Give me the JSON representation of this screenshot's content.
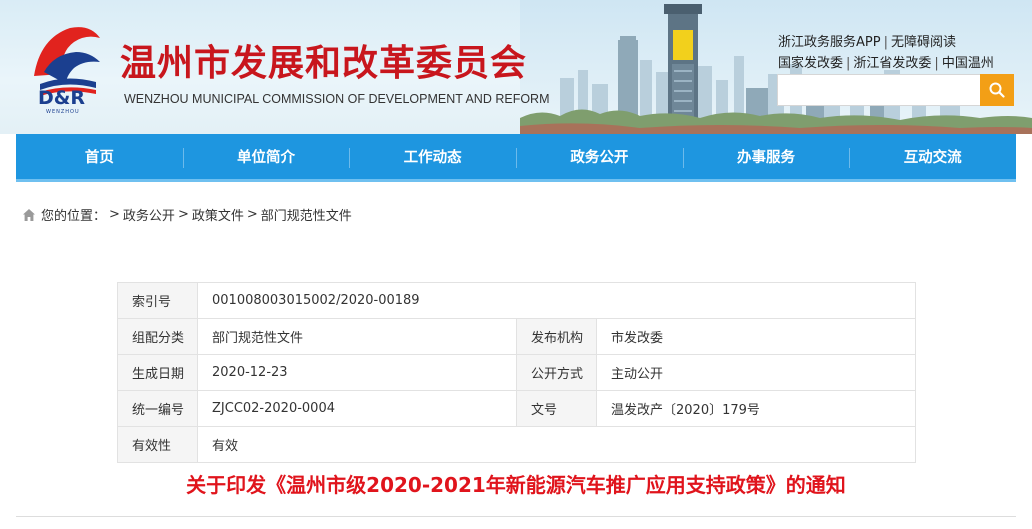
{
  "header": {
    "logo_text": "D&R",
    "logo_subtext": "WENZHOU",
    "site_title": "温州市发展和改革委员会",
    "site_title_en": "WENZHOU MUNICIPAL COMMISSION OF DEVELOPMENT AND REFORM",
    "links_row1": [
      "浙江政务服务APP",
      "无障碍阅读"
    ],
    "links_row2": [
      "国家发改委",
      "浙江省发改委",
      "中国温州"
    ],
    "separator": "|",
    "search": {
      "placeholder": "",
      "icon": "search-icon"
    },
    "accent_color": "#f39f16"
  },
  "nav": {
    "items": [
      "首页",
      "单位简介",
      "工作动态",
      "政务公开",
      "办事服务",
      "互动交流"
    ],
    "color": "#1e96e0"
  },
  "breadcrumb": {
    "prefix": "您的位置：",
    "items": [
      "政务公开",
      "政策文件",
      "部门规范性文件"
    ],
    "separator": ">"
  },
  "info_table": {
    "rows": [
      {
        "label1": "索引号",
        "value1": "001008003015002/2020-00189",
        "label2": "",
        "value2": ""
      },
      {
        "label1": "组配分类",
        "value1": "部门规范性文件",
        "label2": "发布机构",
        "value2": "市发改委"
      },
      {
        "label1": "生成日期",
        "value1": "2020-12-23",
        "label2": "公开方式",
        "value2": "主动公开"
      },
      {
        "label1": "统一编号",
        "value1": "ZJCC02-2020-0004",
        "label2": "文号",
        "value2": "温发改产〔2020〕179号"
      },
      {
        "label1": "有效性",
        "value1": "有效",
        "label2": "",
        "value2": ""
      }
    ]
  },
  "document": {
    "title": "关于印发《温州市级2020-2021年新能源汽车推广应用支持政策》的通知",
    "title_color": "#e0141c"
  }
}
